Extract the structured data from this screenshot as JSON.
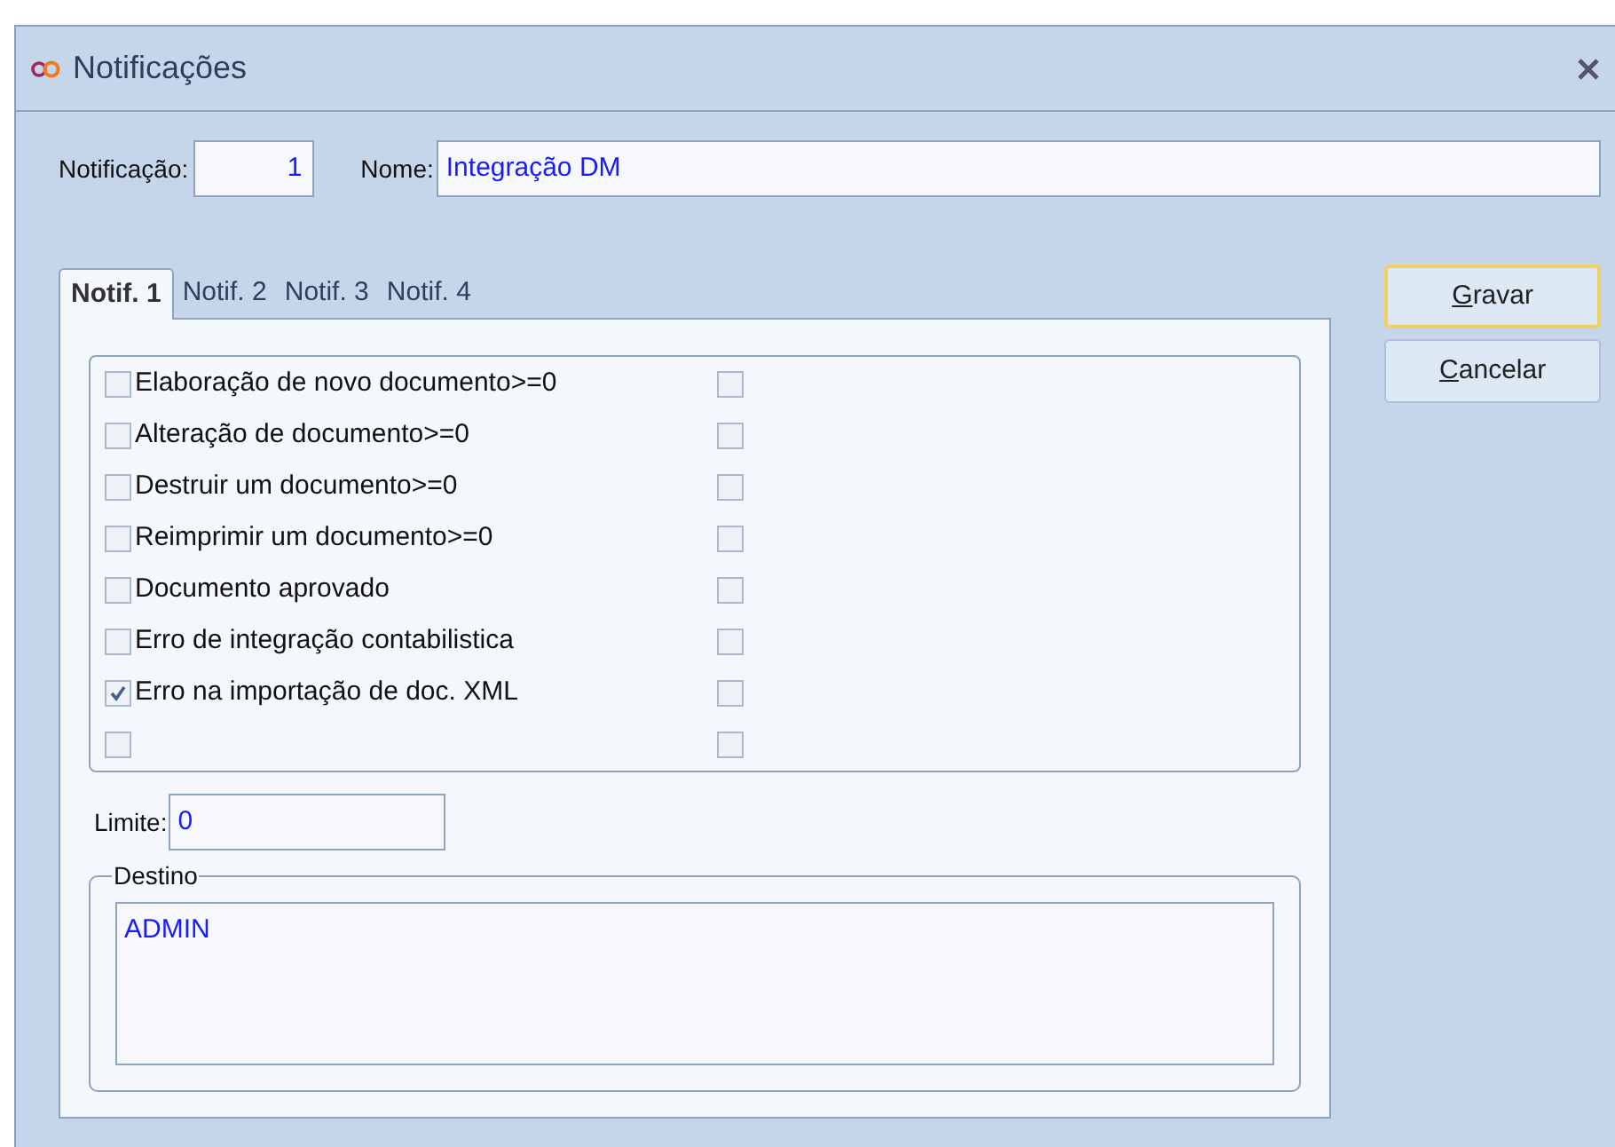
{
  "window": {
    "title": "Notificações"
  },
  "notificacao": {
    "label": "Notificação:",
    "value": "1"
  },
  "nome": {
    "label": "Nome:",
    "value": "Integração DM"
  },
  "tabs": [
    {
      "label": "Notif. 1",
      "selected": true
    },
    {
      "label": "Notif. 2",
      "selected": false
    },
    {
      "label": "Notif. 3",
      "selected": false
    },
    {
      "label": "Notif. 4",
      "selected": false
    }
  ],
  "events": [
    {
      "label": "Elaboração de novo documento>=0",
      "checked": false,
      "extra_checked": false
    },
    {
      "label": "Alteração de documento>=0",
      "checked": false,
      "extra_checked": false
    },
    {
      "label": "Destruir um documento>=0",
      "checked": false,
      "extra_checked": false
    },
    {
      "label": "Reimprimir um documento>=0",
      "checked": false,
      "extra_checked": false
    },
    {
      "label": "Documento aprovado",
      "checked": false,
      "extra_checked": false
    },
    {
      "label": "Erro de integração contabilistica",
      "checked": false,
      "extra_checked": false
    },
    {
      "label": "Erro na importação de doc. XML",
      "checked": true,
      "extra_checked": false
    },
    {
      "checked": false,
      "extra_checked": false
    }
  ],
  "limite": {
    "label": "Limite:",
    "value": "0"
  },
  "destino": {
    "title": "Destino",
    "value": "ADMIN"
  },
  "buttons": [
    {
      "label": "Gravar",
      "focused": true
    },
    {
      "label": "Cancelar",
      "focused": false
    }
  ]
}
